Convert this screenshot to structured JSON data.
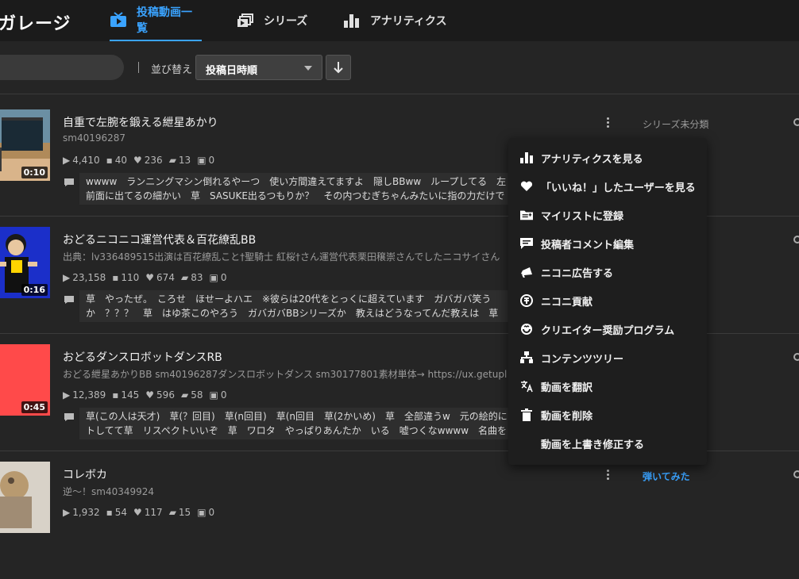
{
  "app": {
    "brand": "ガレージ"
  },
  "nav": {
    "tabs": [
      {
        "label": "投稿動画一覧",
        "icon": "tv-play-icon",
        "active": true
      },
      {
        "label": "シリーズ",
        "icon": "series-stack-icon",
        "active": false
      },
      {
        "label": "アナリティクス",
        "icon": "bar-chart-icon",
        "active": false
      }
    ]
  },
  "toolbar": {
    "sort_label": "並び替え",
    "sort_value": "投稿日時順",
    "sort_direction_icon": "arrow-down-icon"
  },
  "videos": [
    {
      "title": "自重で左腕を鍛える紲星あかり",
      "sub": "sm40196287",
      "duration": "0:10",
      "views": "4,410",
      "comments": "40",
      "likes": "236",
      "mylists": "13",
      "gifts": "0",
      "comment_line1": "wwww　ランニングマシン倒れるやーつ　使い方間違えてますよ　隠しBBww　ループしてる　左",
      "comment_line2": "前面に出てるの細かい　草　SASUKE出るつもりか？　その内つむぎちゃんみたいに指の力だけで",
      "series": "シリーズ未分類",
      "series_link": false
    },
    {
      "title": "おどるニコニコ運営代表＆百花繚乱BB",
      "sub": "出典：lv336489515出演は百花繚乱こと†聖騎士 紅桜†さん運営代表栗田穣崇さんでしたニコサイさん",
      "duration": "0:16",
      "views": "23,158",
      "comments": "110",
      "likes": "674",
      "mylists": "83",
      "gifts": "0",
      "comment_line1": "草　やったぜ。　ころせ　ほせーよハエ　※彼らは20代をとっくに超えています　ガバガバ笑う",
      "comment_line2": "か　？？？　草　はゆ茶このやろう　ガバガバBBシリーズか　教えはどうなってんだ教えは　草",
      "series": "",
      "series_link": false
    },
    {
      "title": "おどるダンスロボットダンスRB",
      "sub": "おどる紲星あかりBB sm40196287ダンスロボットダンス sm30177801素材単体→ https://ux.getupl",
      "duration": "0:45",
      "views": "12,389",
      "comments": "145",
      "likes": "596",
      "mylists": "58",
      "gifts": "0",
      "comment_line1": "草(この人は天才)　草(？回目)　草(n回目)　草(n回目　草(2かいめ)　草　全部違うw　元の絵的に",
      "comment_line2": "トしてて草　リスペクトいいぞ　草　ワロタ　やっぱりあんたか　いる　嘘つくなwwww　名曲を",
      "series": "",
      "series_link": false
    },
    {
      "title": "コレボカ",
      "sub": "逆～！sm40349924",
      "duration": "",
      "views": "1,932",
      "comments": "54",
      "likes": "117",
      "mylists": "15",
      "gifts": "0",
      "comment_line1": "",
      "comment_line2": "",
      "series": "弾いてみた",
      "series_link": true
    }
  ],
  "context_menu": {
    "items": [
      {
        "label": "アナリティクスを見る",
        "icon": "bar-chart-icon"
      },
      {
        "label": "「いいね！」したユーザーを見る",
        "icon": "heart-icon"
      },
      {
        "label": "マイリストに登録",
        "icon": "mylist-add-icon"
      },
      {
        "label": "投稿者コメント編集",
        "icon": "comment-edit-icon"
      },
      {
        "label": "ニコニ広告する",
        "icon": "megaphone-icon"
      },
      {
        "label": "ニコニ貢献",
        "icon": "contribute-coin-icon"
      },
      {
        "label": "クリエイター奨励プログラム",
        "icon": "reward-badge-icon"
      },
      {
        "label": "コンテンツツリー",
        "icon": "tree-icon"
      },
      {
        "label": "動画を翻訳",
        "icon": "translate-icon"
      },
      {
        "label": "動画を削除",
        "icon": "trash-icon"
      },
      {
        "label": "動画を上書き修正する",
        "icon": ""
      }
    ]
  },
  "colors": {
    "accent": "#3aa3ff",
    "background": "#252525",
    "topbar": "#1b1b1b",
    "menu": "#1e1e1e"
  }
}
